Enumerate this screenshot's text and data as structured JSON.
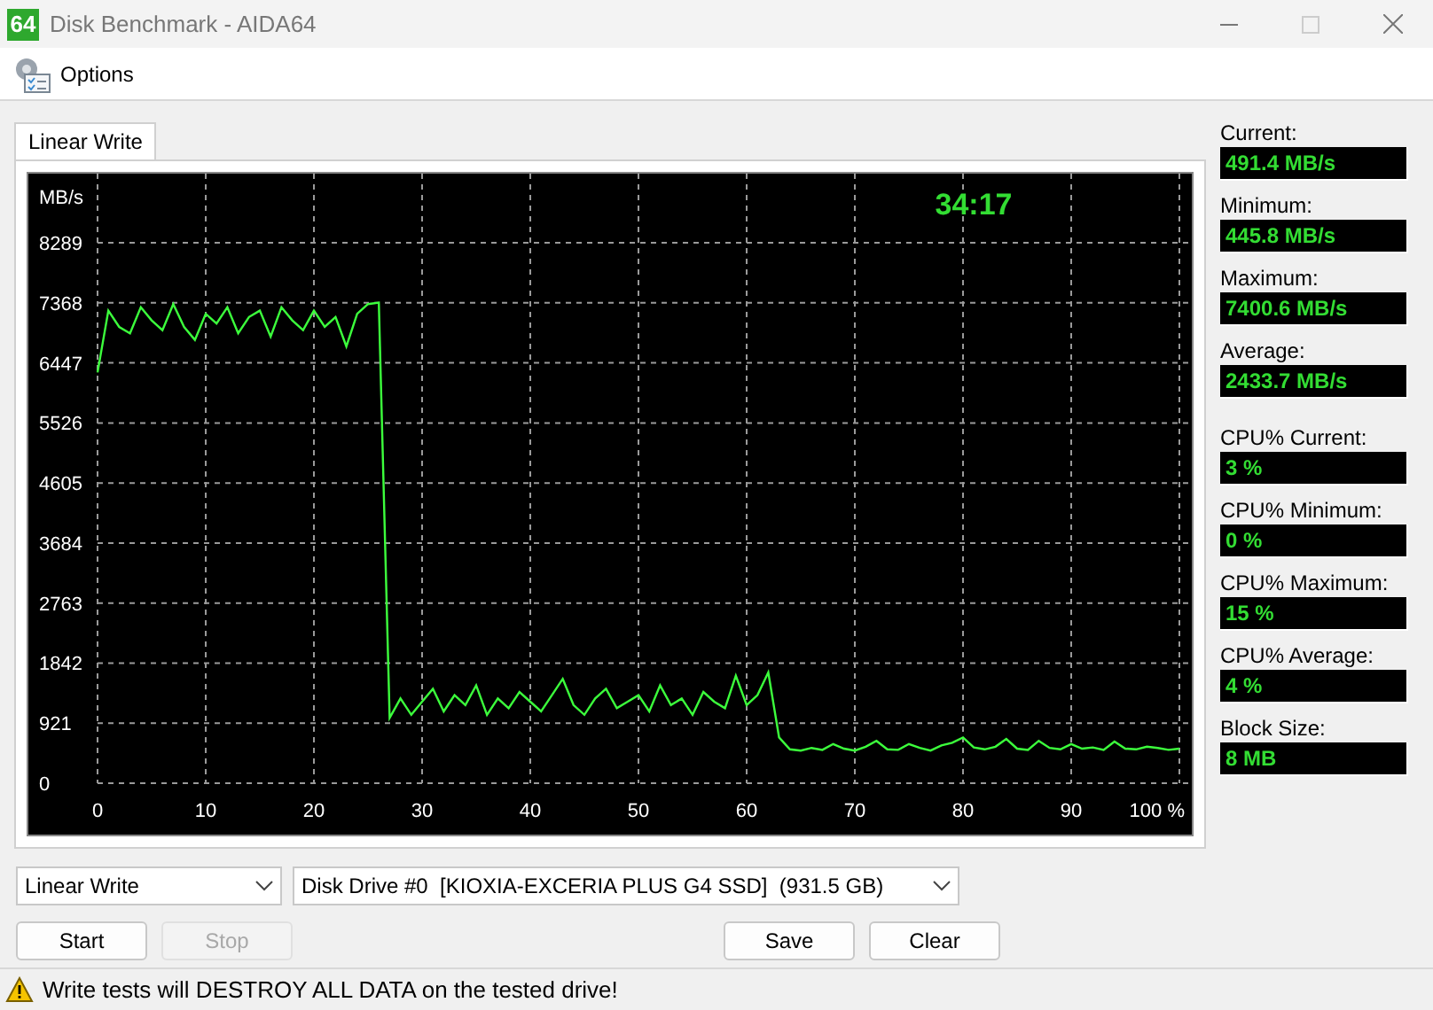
{
  "window": {
    "title": "Disk Benchmark - AIDA64",
    "app_icon": "64"
  },
  "toolbar": {
    "options_label": "Options"
  },
  "tabs": [
    {
      "label": "Linear Write",
      "selected": true
    }
  ],
  "chart": {
    "timer": "34:17",
    "chart_data": {
      "type": "line",
      "ylabel": "MB/s",
      "xlim": [
        0,
        100
      ],
      "ylim": [
        0,
        9350
      ],
      "grid": true,
      "xticks": [
        0,
        10,
        20,
        30,
        40,
        50,
        60,
        70,
        80,
        90,
        {
          "value": 100,
          "label": "100 %"
        }
      ],
      "yticks": [
        0,
        921,
        1842,
        2763,
        3684,
        4605,
        5526,
        6447,
        7368,
        8289
      ],
      "x": [
        0,
        1,
        2,
        3,
        4,
        5,
        6,
        7,
        8,
        9,
        10,
        11,
        12,
        13,
        14,
        15,
        16,
        17,
        18,
        19,
        20,
        21,
        22,
        23,
        24,
        25,
        26,
        27,
        28,
        29,
        30,
        31,
        32,
        33,
        34,
        35,
        36,
        37,
        38,
        39,
        40,
        41,
        42,
        43,
        44,
        45,
        46,
        47,
        48,
        49,
        50,
        51,
        52,
        53,
        54,
        55,
        56,
        57,
        58,
        59,
        60,
        61,
        62,
        63,
        64,
        65,
        66,
        67,
        68,
        69,
        70,
        71,
        72,
        73,
        74,
        75,
        76,
        77,
        78,
        79,
        80,
        81,
        82,
        83,
        84,
        85,
        86,
        87,
        88,
        89,
        90,
        91,
        92,
        93,
        94,
        95,
        96,
        97,
        98,
        99,
        100
      ],
      "series": [
        {
          "color": "#3cff3c",
          "values": [
            6300,
            7250,
            7000,
            6900,
            7300,
            7100,
            6950,
            7350,
            7000,
            6800,
            7200,
            7050,
            7300,
            6900,
            7150,
            7250,
            6850,
            7300,
            7100,
            6950,
            7250,
            7000,
            7150,
            6700,
            7200,
            7350,
            7370,
            1000,
            1300,
            1050,
            1250,
            1450,
            1100,
            1350,
            1200,
            1500,
            1050,
            1300,
            1150,
            1400,
            1250,
            1100,
            1350,
            1600,
            1200,
            1050,
            1300,
            1450,
            1150,
            1250,
            1350,
            1100,
            1500,
            1200,
            1300,
            1050,
            1400,
            1250,
            1150,
            1650,
            1200,
            1350,
            1700,
            700,
            520,
            500,
            540,
            510,
            600,
            530,
            500,
            560,
            650,
            520,
            510,
            600,
            540,
            500,
            580,
            620,
            700,
            550,
            520,
            560,
            680,
            530,
            510,
            650,
            540,
            520,
            600,
            530,
            550,
            510,
            640,
            530,
            520,
            560,
            540,
            510,
            530
          ]
        }
      ]
    }
  },
  "stats": [
    {
      "label": "Current:",
      "value": "491.4 MB/s"
    },
    {
      "label": "Minimum:",
      "value": "445.8 MB/s"
    },
    {
      "label": "Maximum:",
      "value": "7400.6 MB/s"
    },
    {
      "label": "Average:",
      "value": "2433.7 MB/s"
    },
    {
      "label": "CPU% Current:",
      "value": "3 %"
    },
    {
      "label": "CPU% Minimum:",
      "value": "0 %"
    },
    {
      "label": "CPU% Maximum:",
      "value": "15 %"
    },
    {
      "label": "CPU% Average:",
      "value": "4 %"
    },
    {
      "label": "Block Size:",
      "value": "8 MB"
    }
  ],
  "test_select": {
    "value": "Linear Write"
  },
  "drive_select": {
    "value": "Disk Drive #0  [KIOXIA-EXCERIA PLUS G4 SSD]  (931.5 GB)"
  },
  "buttons": [
    {
      "label": "Start",
      "disabled": false
    },
    {
      "label": "Stop",
      "disabled": true
    },
    {
      "label": "Save",
      "disabled": false
    },
    {
      "label": "Clear",
      "disabled": false
    }
  ],
  "status_bar": {
    "message": "Write tests will DESTROY ALL DATA on the tested drive!"
  }
}
